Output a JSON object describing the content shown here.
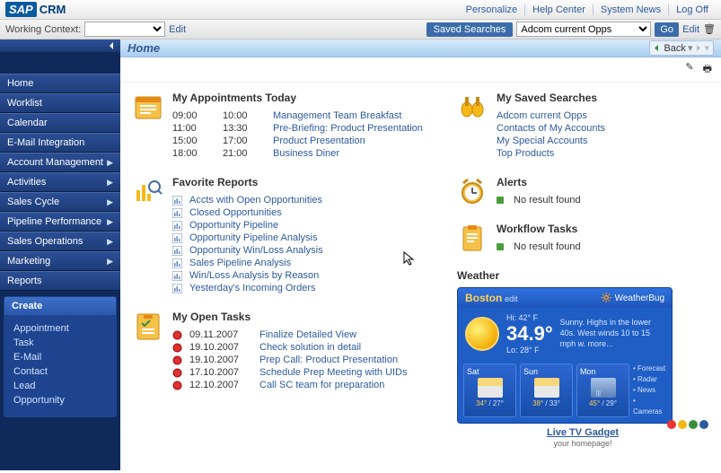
{
  "header": {
    "logo_sap": "SAP",
    "logo_crm": "CRM",
    "links": {
      "personalize": "Personalize",
      "help": "Help Center",
      "news": "System News",
      "logoff": "Log Off"
    }
  },
  "subbar": {
    "wc_label": "Working Context:",
    "wc_value": "",
    "wc_edit": "Edit",
    "saved_label": "Saved Searches",
    "saved_selected": "Adcom current Opps",
    "go": "Go",
    "edit": "Edit"
  },
  "nav": {
    "items": [
      {
        "label": "Home",
        "has_chev": false
      },
      {
        "label": "Worklist",
        "has_chev": false
      },
      {
        "label": "Calendar",
        "has_chev": false
      },
      {
        "label": "E-Mail Integration",
        "has_chev": false
      },
      {
        "label": "Account Management",
        "has_chev": true
      },
      {
        "label": "Activities",
        "has_chev": true
      },
      {
        "label": "Sales Cycle",
        "has_chev": true
      },
      {
        "label": "Pipeline Performance",
        "has_chev": true
      },
      {
        "label": "Sales Operations",
        "has_chev": true
      },
      {
        "label": "Marketing",
        "has_chev": true
      },
      {
        "label": "Reports",
        "has_chev": false
      }
    ],
    "create_head": "Create",
    "create": [
      "Appointment",
      "Task",
      "E-Mail",
      "Contact",
      "Lead",
      "Opportunity"
    ]
  },
  "titlebar": {
    "title": "Home",
    "back": "Back"
  },
  "appointments": {
    "head": "My Appointments Today",
    "rows": [
      {
        "t1": "09:00",
        "t2": "10:00",
        "label": "Management Team Breakfast"
      },
      {
        "t1": "11:00",
        "t2": "13:30",
        "label": "Pre-Briefing: Product Presentation"
      },
      {
        "t1": "15:00",
        "t2": "17:00",
        "label": "Product Presentation"
      },
      {
        "t1": "18:00",
        "t2": "21:00",
        "label": "Business Diner"
      }
    ]
  },
  "reports": {
    "head": "Favorite Reports",
    "rows": [
      "Accts with Open Opportunities",
      "Closed Opportunities",
      "Opportunity Pipeline",
      "Opportunity Pipeline Analysis",
      "Opportunity Win/Loss Analysis",
      "Sales Pipeline Analysis",
      "Win/Loss Analysis by Reason",
      "Yesterday's Incoming Orders"
    ]
  },
  "tasks": {
    "head": "My Open Tasks",
    "rows": [
      {
        "date": "09.11.2007",
        "label": "Finalize Detailed View"
      },
      {
        "date": "19.10.2007",
        "label": "Check solution in detail"
      },
      {
        "date": "19.10.2007",
        "label": "Prep Call: Product Presentation"
      },
      {
        "date": "17.10.2007",
        "label": "Schedule Prep Meeting with UIDs"
      },
      {
        "date": "12.10.2007",
        "label": "Call SC team for preparation"
      }
    ]
  },
  "saved_searches": {
    "head": "My Saved Searches",
    "rows": [
      "Adcom current Opps",
      "Contacts of My Accounts",
      "My Special Accounts",
      "Top Products"
    ]
  },
  "alerts": {
    "head": "Alerts",
    "msg": "No result found"
  },
  "workflow": {
    "head": "Workflow Tasks",
    "msg": "No result found"
  },
  "weather": {
    "head": "Weather",
    "city": "Boston",
    "edit": "edit",
    "brand": "WeatherBug",
    "hi": "Hi: 42° F",
    "temp": "34.9°",
    "lo": "Lo: 28° F",
    "cond": "Sunny. Highs in the lower 40s. West winds 10 to 15 mph w. more...",
    "days": [
      {
        "d": "Sat",
        "t": "34° / 27°",
        "icon": "sun-cloud"
      },
      {
        "d": "Sun",
        "t": "38° / 33°",
        "icon": "sun-cloud"
      },
      {
        "d": "Mon",
        "t": "45° / 29°",
        "icon": "rain"
      }
    ],
    "links": [
      "Forecast",
      "Radar",
      "News",
      "Cameras"
    ],
    "footer": "Live TV Gadget",
    "footer_sub": "your homepage!"
  }
}
